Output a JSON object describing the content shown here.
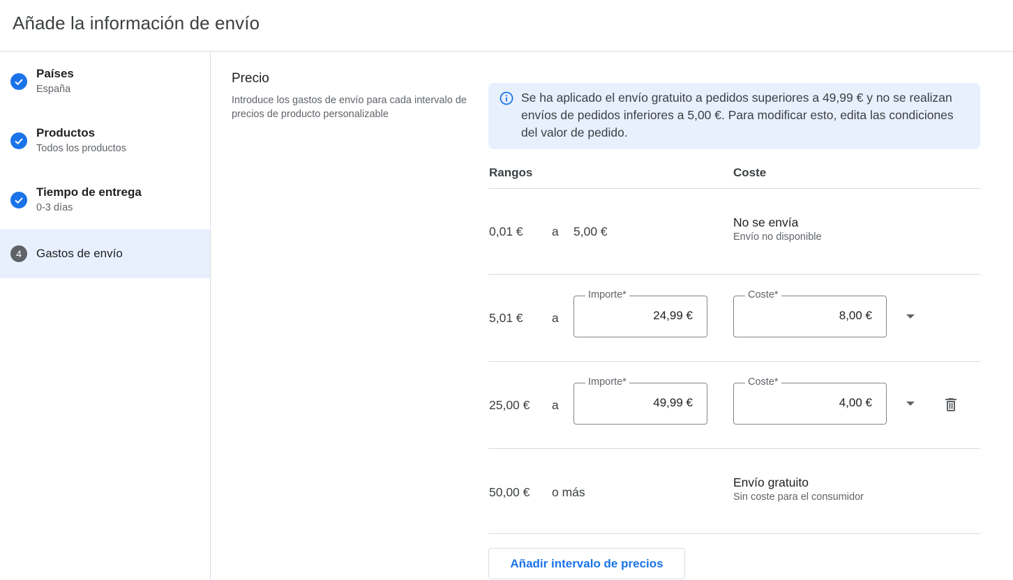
{
  "header": {
    "title": "Añade la información de envío"
  },
  "sidebar": {
    "steps": [
      {
        "title": "Países",
        "subtitle": "España",
        "status": "done"
      },
      {
        "title": "Productos",
        "subtitle": "Todos los productos",
        "status": "done"
      },
      {
        "title": "Tiempo de entrega",
        "subtitle": "0-3 días",
        "status": "done"
      },
      {
        "number": "4",
        "title": "Gastos de envío",
        "status": "active"
      }
    ]
  },
  "section": {
    "title": "Precio",
    "description": "Introduce los gastos de envío para cada intervalo de precios de producto personalizable"
  },
  "info_banner": {
    "icon": "info-icon",
    "text": "Se ha aplicado el envío gratuito a pedidos superiores a 49,99 € y no se realizan envíos de pedidos inferiores a 5,00 €. Para modificar esto, edita las condiciones del valor de pedido."
  },
  "table": {
    "col_ranges": "Rangos",
    "col_cost": "Coste",
    "rows": [
      {
        "from": "0,01 €",
        "sep": "a",
        "to": "5,00 €",
        "cost_title": "No se envía",
        "cost_sub": "Envío no disponible"
      },
      {
        "from": "5,01 €",
        "sep": "a",
        "amount_label": "Importe*",
        "amount_value": "24,99 €",
        "cost_label": "Coste*",
        "cost_value": "8,00 €"
      },
      {
        "from": "25,00 €",
        "sep": "a",
        "amount_label": "Importe*",
        "amount_value": "49,99 €",
        "cost_label": "Coste*",
        "cost_value": "4,00 €"
      },
      {
        "from": "50,00 €",
        "sep": "o más",
        "cost_title": "Envío gratuito",
        "cost_sub": "Sin coste para el consumidor"
      }
    ]
  },
  "add_button": {
    "label": "Añadir intervalo de precios"
  },
  "colors": {
    "accent": "#1a73e8",
    "active_bg": "#e8f0fe",
    "info_bg": "#e8f0fe",
    "divider": "#dadce0"
  }
}
